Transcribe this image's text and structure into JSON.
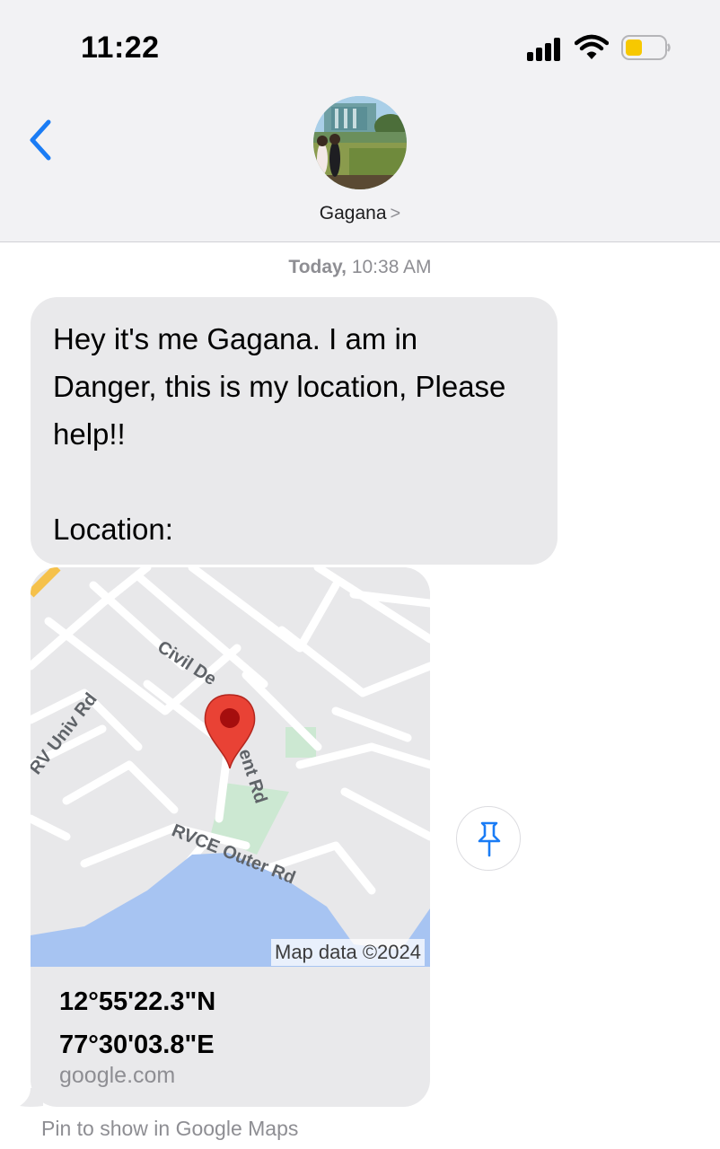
{
  "status_bar": {
    "time": "11:22",
    "icons": [
      "signal-icon",
      "wifi-icon",
      "battery-icon"
    ]
  },
  "header": {
    "back_icon": "chevron-left-icon",
    "contact_name": "Gagana",
    "contact_chevron": ">"
  },
  "conversation": {
    "timestamp_day": "Today,",
    "timestamp_time": "10:38 AM",
    "message_text": "Hey it's me Gagana. I am in\nDanger, this is my location, Please\nhelp!!\n\nLocation:",
    "link_preview": {
      "map_labels": [
        "Civil De",
        "ent Rd",
        "RV Univ Rd",
        "RVCE Outer Rd"
      ],
      "map_attribution": "Map data ©2024",
      "coord_lat": "12°55'22.3\"N",
      "coord_lon": "77°30'03.8\"E",
      "domain": "google.com"
    },
    "pin_icon": "pushpin-icon",
    "pin_caption": "Pin to show in Google Maps"
  },
  "colors": {
    "accent_blue": "#1a7cf5",
    "bubble_gray": "#e9e9eb",
    "header_bg": "#f2f2f4",
    "map_pin_red": "#e94235",
    "water_blue": "#a7c4f2",
    "park_green": "#cce8d2",
    "battery_yellow": "#f7c800"
  }
}
